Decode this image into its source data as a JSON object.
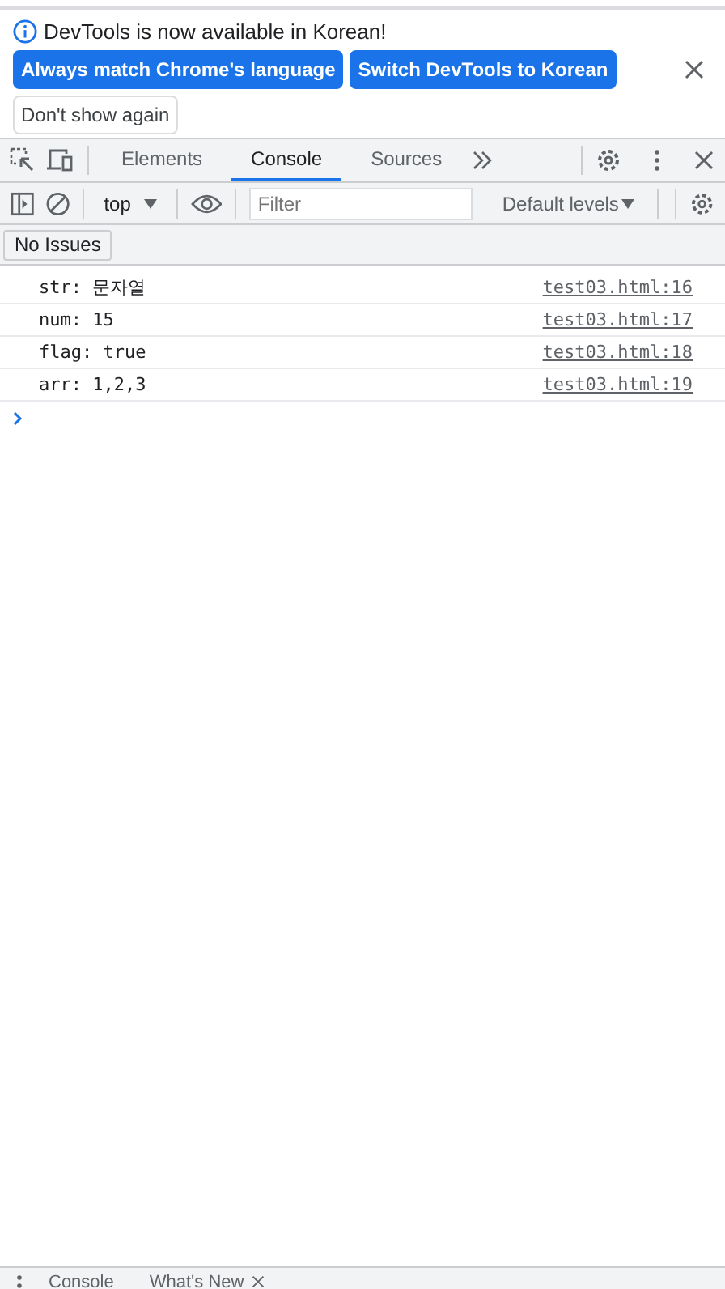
{
  "infobar": {
    "message": "DevTools is now available in Korean!",
    "actions": [
      {
        "label": "Always match Chrome's language",
        "kind": "primary"
      },
      {
        "label": "Switch DevTools to Korean",
        "kind": "primary"
      },
      {
        "label": "Don't show again",
        "kind": "secondary"
      }
    ]
  },
  "tabs": [
    {
      "label": "Elements",
      "selected": false
    },
    {
      "label": "Console",
      "selected": true
    },
    {
      "label": "Sources",
      "selected": false
    }
  ],
  "console_toolbar": {
    "context": "top",
    "filter_placeholder": "Filter",
    "levels": "Default levels"
  },
  "issues": "No Issues",
  "messages": [
    {
      "text": "str: 문자열",
      "source": "test03.html:16"
    },
    {
      "text": "num: 15",
      "source": "test03.html:17"
    },
    {
      "text": "flag: true",
      "source": "test03.html:18"
    },
    {
      "text": "arr: 1,2,3",
      "source": "test03.html:19"
    }
  ],
  "drawer_tabs": [
    {
      "label": "Console",
      "closable": false
    },
    {
      "label": "What's New",
      "closable": true
    }
  ]
}
